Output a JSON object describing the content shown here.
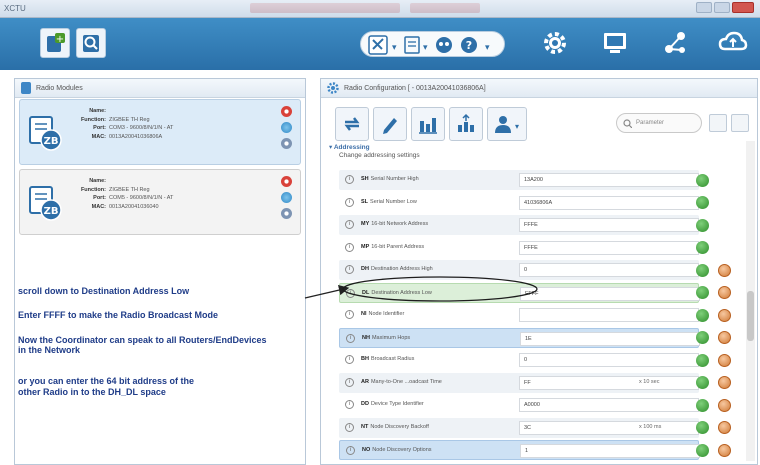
{
  "window": {
    "app_title": "XCTU"
  },
  "toolbar": {
    "add_device_label": "+",
    "discover_label": "Q",
    "help_label": "?"
  },
  "left_panel": {
    "title": "Radio Modules",
    "modules": [
      {
        "name_label": "Name:",
        "name_value": "",
        "function_label": "Function:",
        "function_value": "ZIGBEE TH Reg",
        "port_label": "Port:",
        "port_value": "COM3 - 9600/8/N/1/N - AT",
        "mac_label": "MAC:",
        "mac_value": "0013A20041036806A",
        "badge": "ZB"
      },
      {
        "name_label": "Name:",
        "name_value": "",
        "function_label": "Function:",
        "function_value": "ZIGBEE TH Reg",
        "port_label": "Port:",
        "port_value": "COM5 - 9600/8/N/1/N - AT",
        "mac_label": "MAC:",
        "mac_value": "0013A20041036040",
        "badge": "ZB"
      }
    ]
  },
  "instructions": [
    "scroll down to Destination Address Low",
    "Enter FFFF to make the Radio Broadcast Mode",
    "Now the Coordinator can speak to all Routers/EndDevices",
    "in the Network",
    "or you can enter the   64 bit  address of the",
    " other Radio in to the DH_DL space"
  ],
  "right_panel": {
    "title": "Radio Configuration [ - 0013A20041036806A]",
    "search_placeholder": "Parameter",
    "section_title": "Addressing",
    "section_subtitle": "Change addressing settings",
    "rows": [
      {
        "code": "SH",
        "name": "Serial Number High",
        "value": "13A200",
        "unit": "",
        "writable": false,
        "style": "alt"
      },
      {
        "code": "SL",
        "name": "Serial Number Low",
        "value": "41036806A",
        "unit": "",
        "writable": false,
        "style": "plain"
      },
      {
        "code": "MY",
        "name": "16-bit Network Address",
        "value": "FFFE",
        "unit": "",
        "writable": false,
        "style": "alt"
      },
      {
        "code": "MP",
        "name": "16-bit Parent Address",
        "value": "FFFE",
        "unit": "",
        "writable": false,
        "style": "plain"
      },
      {
        "code": "DH",
        "name": "Destination Address High",
        "value": "0",
        "unit": "",
        "writable": true,
        "style": "alt"
      },
      {
        "code": "DL",
        "name": "Destination Address Low",
        "value": "FFFF",
        "unit": "",
        "writable": true,
        "style": "hl-green"
      },
      {
        "code": "NI",
        "name": "Node Identifier",
        "value": "",
        "unit": "",
        "writable": true,
        "style": "plain"
      },
      {
        "code": "NH",
        "name": "Maximum Hops",
        "value": "1E",
        "unit": "",
        "writable": true,
        "style": "hl-blue"
      },
      {
        "code": "BH",
        "name": "Broadcast Radius",
        "value": "0",
        "unit": "",
        "writable": true,
        "style": "plain"
      },
      {
        "code": "AR",
        "name": "Many-to-One ...oadcast Time",
        "value": "FF",
        "unit": "x 10 sec",
        "writable": true,
        "style": "alt"
      },
      {
        "code": "DD",
        "name": "Device Type Identifier",
        "value": "A0000",
        "unit": "",
        "writable": true,
        "style": "plain"
      },
      {
        "code": "NT",
        "name": "Node Discovery Backoff",
        "value": "3C",
        "unit": "x 100 ms",
        "writable": true,
        "style": "alt"
      },
      {
        "code": "NO",
        "name": "Node Discovery Options",
        "value": "1",
        "unit": "",
        "writable": true,
        "style": "hl-blue"
      }
    ]
  },
  "colors": {
    "toolbar_blue": "#3584bf",
    "instruction_text": "#1f3c88",
    "read_button": "#3ea33a",
    "write_button": "#d98a45"
  }
}
